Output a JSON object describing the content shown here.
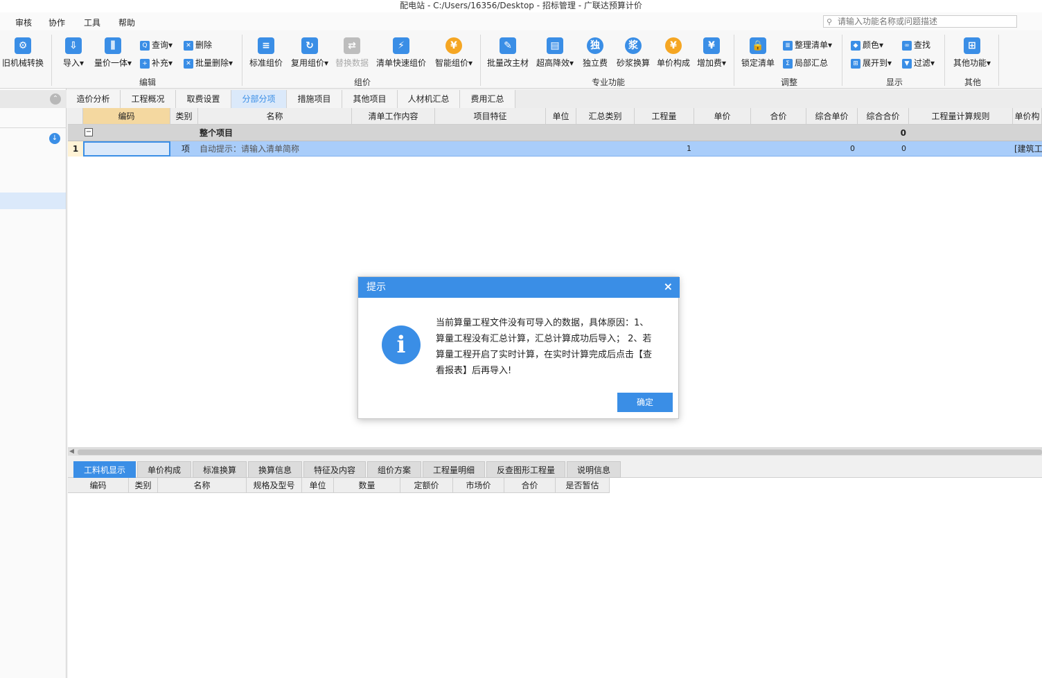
{
  "window": {
    "title": "配电站 - C:/Users/16356/Desktop - 招标管理 - 广联达预算计价"
  },
  "menu": {
    "items": [
      "审核",
      "协作",
      "工具",
      "帮助"
    ]
  },
  "search": {
    "placeholder": "请输入功能名称或问题描述"
  },
  "ribbon": {
    "partial_first": "旧机械转换",
    "edit": {
      "title": "编辑",
      "import": "导入",
      "qty_price": "量价一体",
      "query": "查询",
      "supplement": "补充",
      "delete": "删除",
      "batch_delete": "批量删除"
    },
    "group_price": {
      "title": "组价",
      "standard": "标准组价",
      "reuse": "复用组价",
      "replace": "替换数据",
      "quick": "清单快速组价",
      "smart": "智能组价"
    },
    "special": {
      "title": "专业功能",
      "batch_main": "批量改主材",
      "height": "超高降效",
      "independent": "独立费",
      "mortar": "砂浆换算",
      "unit_comp": "单价构成",
      "add_fee": "增加费"
    },
    "adjust": {
      "title": "调整",
      "lock": "锁定清单",
      "organize": "整理清单",
      "local_sum": "局部汇总"
    },
    "display": {
      "title": "显示",
      "color": "颜色",
      "find": "查找",
      "expand": "展开到",
      "filter": "过滤"
    },
    "other": {
      "title": "其他",
      "more": "其他功能"
    }
  },
  "main_tabs": [
    "造价分析",
    "工程概况",
    "取费设置",
    "分部分项",
    "措施项目",
    "其他项目",
    "人材机汇总",
    "费用汇总"
  ],
  "grid": {
    "headers": [
      "编码",
      "类别",
      "名称",
      "清单工作内容",
      "项目特征",
      "单位",
      "汇总类别",
      "工程量",
      "单价",
      "合价",
      "综合单价",
      "综合合价",
      "工程量计算规则",
      "单价构"
    ],
    "group_row": {
      "toggle": "−",
      "name": "整个项目",
      "total": "0"
    },
    "item_row": {
      "index": "1",
      "type": "项",
      "name": "自动提示：请输入清单简称",
      "qty": "1",
      "unit_total": "0",
      "total": "0",
      "rule": "[建筑工"
    }
  },
  "bottom_tabs": [
    "工料机显示",
    "单价构成",
    "标准换算",
    "换算信息",
    "特征及内容",
    "组价方案",
    "工程量明细",
    "反查图形工程量",
    "说明信息"
  ],
  "sub_grid": {
    "headers": [
      "编码",
      "类别",
      "名称",
      "规格及型号",
      "单位",
      "数量",
      "定额价",
      "市场价",
      "合价",
      "是否暂估"
    ]
  },
  "dialog": {
    "title": "提示",
    "close": "×",
    "icon": "i",
    "message": "当前算量工程文件没有可导入的数据，具体原因：1、算量工程没有汇总计算，汇总计算成功后导入； 2、若算量工程开启了实时计算，在实时计算完成后点击【查看报表】后再导入!",
    "ok": "确定"
  },
  "colors": {
    "accent": "#3a8ee6",
    "selected_row": "#a9cdfa",
    "group_row": "#d4d4d4"
  }
}
